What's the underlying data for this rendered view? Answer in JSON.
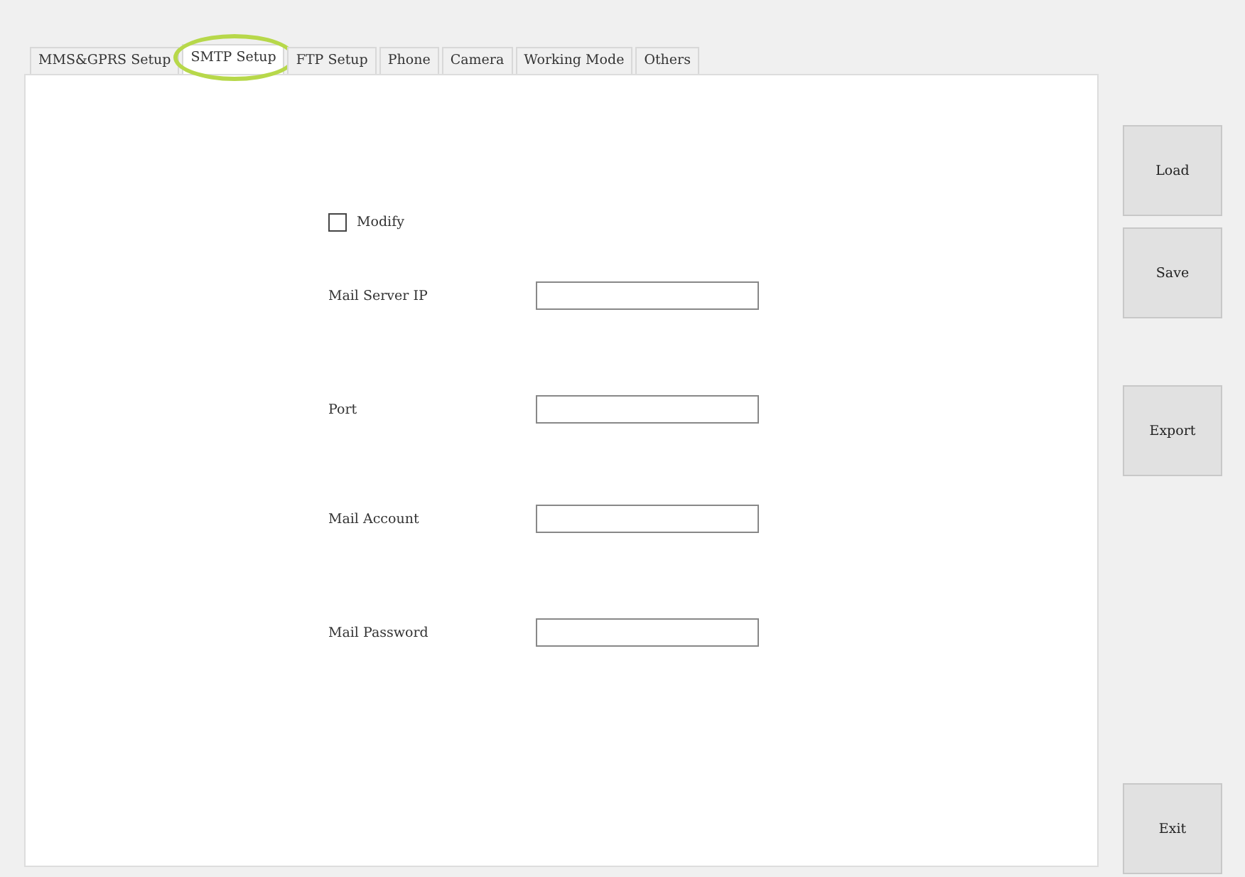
{
  "tabs": [
    {
      "label": "MMS&GPRS Setup",
      "selected": false
    },
    {
      "label": "SMTP Setup",
      "selected": true,
      "highlighted": true
    },
    {
      "label": "FTP Setup",
      "selected": false
    },
    {
      "label": "Phone",
      "selected": false
    },
    {
      "label": "Camera",
      "selected": false
    },
    {
      "label": "Working Mode",
      "selected": false
    },
    {
      "label": "Others",
      "selected": false
    }
  ],
  "modify": {
    "label": "Modify",
    "checked": false
  },
  "fields": [
    {
      "label": "Mail Server IP"
    },
    {
      "label": "Port"
    },
    {
      "label": "Mail Account"
    },
    {
      "label": "Mail Password"
    }
  ],
  "buttons": [
    {
      "label": "Load",
      "kind": "action"
    },
    {
      "label": "Save",
      "kind": "action"
    },
    {
      "label": "Export",
      "kind": "action"
    },
    {
      "label": "Exit",
      "kind": "exit"
    }
  ]
}
